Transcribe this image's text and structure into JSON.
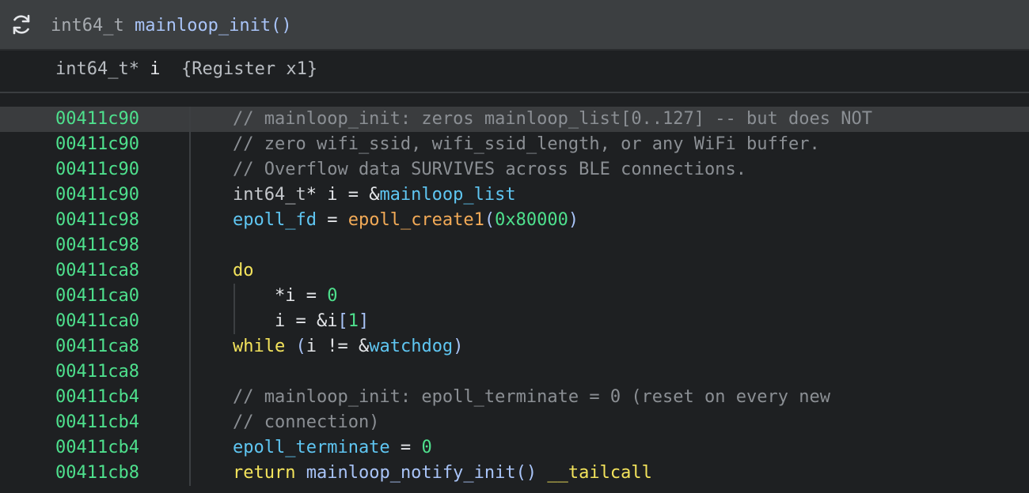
{
  "header": {
    "refresh_icon": "refresh-icon",
    "return_type": "int64_t",
    "function_name": "mainloop_init()"
  },
  "variables": [
    {
      "type": "int64_t*",
      "name": "i",
      "storage": "{Register x1}"
    }
  ],
  "lines": [
    {
      "address": "00411c90",
      "highlighted": true,
      "tokens": [
        {
          "t": "// mainloop_init: zeros mainloop_list[0..127] -- but does NOT",
          "k": "comment"
        }
      ]
    },
    {
      "address": "00411c90",
      "tokens": [
        {
          "t": "// zero wifi_ssid, wifi_ssid_length, or any WiFi buffer.",
          "k": "comment"
        }
      ]
    },
    {
      "address": "00411c90",
      "tokens": [
        {
          "t": "// Overflow data SURVIVES across BLE connections.",
          "k": "comment"
        }
      ]
    },
    {
      "address": "00411c90",
      "tokens": [
        {
          "t": "int64_t",
          "k": "type"
        },
        {
          "t": "* i = &",
          "k": "plain"
        },
        {
          "t": "mainloop_list",
          "k": "global"
        }
      ]
    },
    {
      "address": "00411c98",
      "tokens": [
        {
          "t": "epoll_fd",
          "k": "global"
        },
        {
          "t": " = ",
          "k": "plain"
        },
        {
          "t": "epoll_create1",
          "k": "func"
        },
        {
          "t": "(",
          "k": "paren"
        },
        {
          "t": "0x80000",
          "k": "num"
        },
        {
          "t": ")",
          "k": "paren"
        }
      ]
    },
    {
      "address": "00411c98",
      "tokens": []
    },
    {
      "address": "00411ca8",
      "tokens": [
        {
          "t": "do",
          "k": "kw"
        }
      ]
    },
    {
      "address": "00411ca0",
      "guide": true,
      "tokens": [
        {
          "t": "    *i = ",
          "k": "plain"
        },
        {
          "t": "0",
          "k": "num"
        }
      ]
    },
    {
      "address": "00411ca0",
      "guide": true,
      "tokens": [
        {
          "t": "    i = &i",
          "k": "plain"
        },
        {
          "t": "[",
          "k": "paren"
        },
        {
          "t": "1",
          "k": "num"
        },
        {
          "t": "]",
          "k": "paren"
        }
      ]
    },
    {
      "address": "00411ca8",
      "tokens": [
        {
          "t": "while",
          "k": "kw"
        },
        {
          "t": " ",
          "k": "plain"
        },
        {
          "t": "(",
          "k": "paren"
        },
        {
          "t": "i != &",
          "k": "plain"
        },
        {
          "t": "watchdog",
          "k": "global"
        },
        {
          "t": ")",
          "k": "paren"
        }
      ]
    },
    {
      "address": "00411ca8",
      "tokens": []
    },
    {
      "address": "00411cb4",
      "tokens": [
        {
          "t": "// mainloop_init: epoll_terminate = 0 (reset on every new",
          "k": "comment"
        }
      ]
    },
    {
      "address": "00411cb4",
      "tokens": [
        {
          "t": "// connection)",
          "k": "comment"
        }
      ]
    },
    {
      "address": "00411cb4",
      "tokens": [
        {
          "t": "epoll_terminate",
          "k": "global"
        },
        {
          "t": " = ",
          "k": "plain"
        },
        {
          "t": "0",
          "k": "num"
        }
      ]
    },
    {
      "address": "00411cb8",
      "tokens": [
        {
          "t": "return",
          "k": "kw"
        },
        {
          "t": " ",
          "k": "plain"
        },
        {
          "t": "mainloop_notify_init",
          "k": "callee"
        },
        {
          "t": "() ",
          "k": "callee"
        },
        {
          "t": "__tailcall",
          "k": "tail"
        }
      ]
    }
  ]
}
